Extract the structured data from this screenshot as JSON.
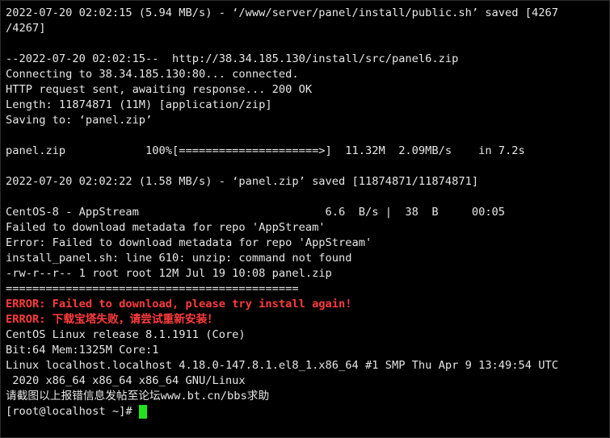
{
  "terminal": {
    "lines": [
      "2022-07-20 02:02:15 (5.94 MB/s) - ‘/www/server/panel/install/public.sh’ saved [4267",
      "/4267]",
      "",
      "--2022-07-20 02:02:15--  http://38.34.185.130/install/src/panel6.zip",
      "Connecting to 38.34.185.130:80... connected.",
      "HTTP request sent, awaiting response... 200 OK",
      "Length: 11874871 (11M) [application/zip]",
      "Saving to: ‘panel.zip’",
      "",
      "panel.zip            100%[=====================>]  11.32M  2.09MB/s    in 7.2s",
      "",
      "2022-07-20 02:02:22 (1.58 MB/s) - ‘panel.zip’ saved [11874871/11874871]",
      "",
      "CentOS-8 - AppStream                            6.6  B/s |  38  B     00:05",
      "Failed to download metadata for repo 'AppStream'",
      "Error: Failed to download metadata for repo 'AppStream'",
      "install_panel.sh: line 610: unzip: command not found",
      "-rw-r--r-- 1 root root 12M Jul 19 10:08 panel.zip",
      "============================================",
      "ERROR: Failed to download, please try install again!",
      "ERROR: 下载宝塔失败，请尝试重新安装！",
      "CentOS Linux release 8.1.1911 (Core)",
      "Bit:64 Mem:1325M Core:1",
      "Linux localhost.localhost 4.18.0-147.8.1.el8_1.x86_64 #1 SMP Thu Apr 9 13:49:54 UTC",
      " 2020 x86_64 x86_64 x86_64 GNU/Linux",
      "请截图以上报错信息发帖至论坛www.bt.cn/bbs求助",
      "[root@localhost ~]#"
    ],
    "colors": {
      "background": "#000000",
      "text": "#e6e6e6",
      "error": "#ff3b3b",
      "cursor": "#1ee61e"
    }
  }
}
